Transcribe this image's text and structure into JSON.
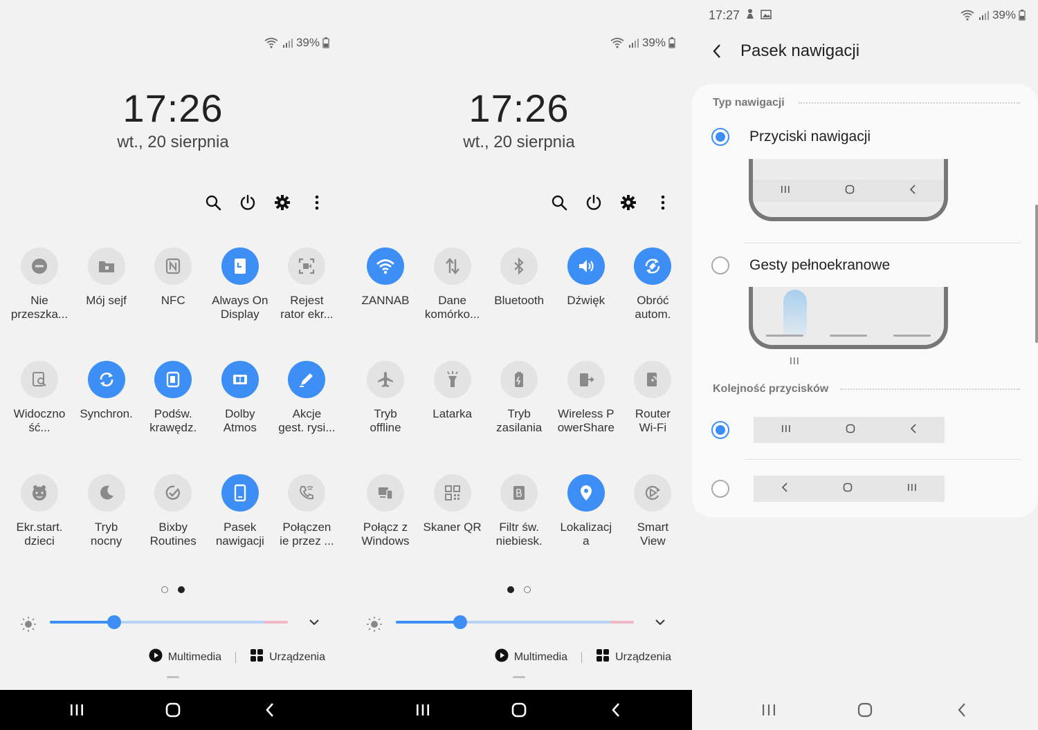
{
  "status": {
    "battery": "39%",
    "time_settings": "17:27"
  },
  "lockscreen": {
    "time": "17:26",
    "date": "wt., 20 sierpnia"
  },
  "page1_tiles": [
    {
      "label": "Nie\nprzeszka...",
      "on": false,
      "icon": "minus-circle-icon"
    },
    {
      "label": "Mój sejf",
      "on": false,
      "icon": "folder-lock-icon"
    },
    {
      "label": "NFC",
      "on": false,
      "icon": "nfc-icon"
    },
    {
      "label": "Always On\nDisplay",
      "on": true,
      "icon": "clock-screen-icon"
    },
    {
      "label": "Rejest\nrator ekr...",
      "on": false,
      "icon": "screen-record-icon"
    },
    {
      "label": "Widoczno\nść...",
      "on": false,
      "icon": "visibility-search-icon"
    },
    {
      "label": "Synchron.",
      "on": true,
      "icon": "sync-icon"
    },
    {
      "label": "Podśw.\nkrawędz.",
      "on": true,
      "icon": "edge-lighting-icon"
    },
    {
      "label": "Dolby\nAtmos",
      "on": true,
      "icon": "dolby-icon"
    },
    {
      "label": "Akcje\ngest. rysi...",
      "on": true,
      "icon": "pen-icon"
    },
    {
      "label": "Ekr.start.\ndzieci",
      "on": false,
      "icon": "kids-face-icon"
    },
    {
      "label": "Tryb\nnocny",
      "on": false,
      "icon": "moon-icon"
    },
    {
      "label": "Bixby\nRoutines",
      "on": false,
      "icon": "routine-check-icon"
    },
    {
      "label": "Pasek\nnawigacji",
      "on": true,
      "icon": "phone-nav-icon"
    },
    {
      "label": "Połączen\nie przez ...",
      "on": false,
      "icon": "wifi-call-icon"
    }
  ],
  "page2_tiles": [
    {
      "label": "ZANNAB",
      "on": true,
      "icon": "wifi-icon"
    },
    {
      "label": "Dane\nkomórko...",
      "on": false,
      "icon": "data-arrows-icon"
    },
    {
      "label": "Bluetooth",
      "on": false,
      "icon": "bluetooth-icon"
    },
    {
      "label": "Dźwięk",
      "on": true,
      "icon": "speaker-icon"
    },
    {
      "label": "Obróć\nautom.",
      "on": true,
      "icon": "rotate-icon"
    },
    {
      "label": "Tryb\noffline",
      "on": false,
      "icon": "airplane-icon"
    },
    {
      "label": "Latarka",
      "on": false,
      "icon": "flashlight-icon"
    },
    {
      "label": "Tryb\nzasilania",
      "on": false,
      "icon": "power-mode-icon"
    },
    {
      "label": "Wireless P\nowerShare",
      "on": false,
      "icon": "powershare-icon"
    },
    {
      "label": "Router\nWi-Fi",
      "on": false,
      "icon": "hotspot-icon"
    },
    {
      "label": "Połącz z\nWindows",
      "on": false,
      "icon": "link-windows-icon"
    },
    {
      "label": "Skaner QR",
      "on": false,
      "icon": "qr-icon"
    },
    {
      "label": "Filtr św.\nniebiesk.",
      "on": false,
      "icon": "blue-filter-icon"
    },
    {
      "label": "Lokalizacj\na",
      "on": true,
      "icon": "location-icon"
    },
    {
      "label": "Smart\nView",
      "on": false,
      "icon": "smart-view-icon"
    }
  ],
  "brightness": {
    "level": 0.27
  },
  "links": {
    "media": "Multimedia",
    "devices": "Urządzenia"
  },
  "settings": {
    "title": "Pasek nawigacji",
    "section_type": "Typ nawigacji",
    "option_buttons": "Przyciski nawigacji",
    "option_gestures": "Gesty pełnoekranowe",
    "section_order": "Kolejność przycisków",
    "selected_type": "buttons",
    "selected_order": 0
  },
  "colors": {
    "accent": "#3d8ef5",
    "tile_off": "#e3e3e3"
  }
}
